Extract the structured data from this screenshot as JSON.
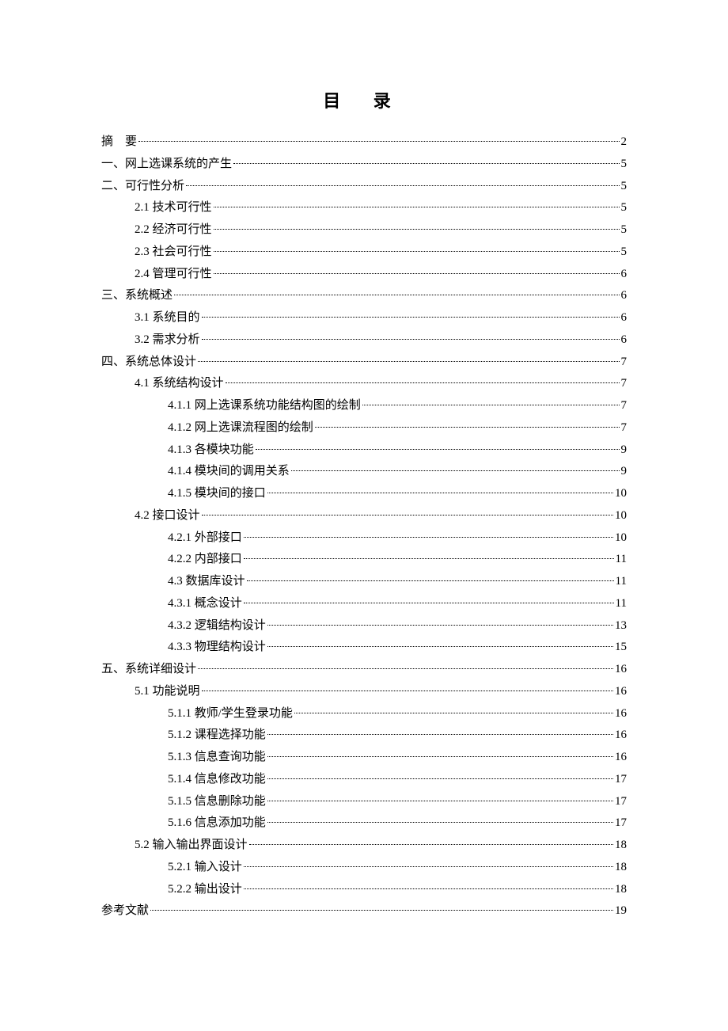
{
  "title": "目 录",
  "entries": [
    {
      "level": 0,
      "label": "摘　要",
      "page": "2"
    },
    {
      "level": 0,
      "label": "一、网上选课系统的产生",
      "page": "5"
    },
    {
      "level": 0,
      "label": "二、可行性分析",
      "page": "5"
    },
    {
      "level": 1,
      "label": "2.1 技术可行性",
      "page": "5"
    },
    {
      "level": 1,
      "label": "2.2 经济可行性",
      "page": "5"
    },
    {
      "level": 1,
      "label": "2.3 社会可行性",
      "page": "5"
    },
    {
      "level": 1,
      "label": "2.4 管理可行性",
      "page": "6"
    },
    {
      "level": 0,
      "label": "三、系统概述",
      "page": "6"
    },
    {
      "level": 1,
      "label": "3.1 系统目的 ",
      "page": "6"
    },
    {
      "level": 1,
      "label": "3.2 需求分析",
      "page": "6"
    },
    {
      "level": 0,
      "label": "四、系统总体设计",
      "page": "7"
    },
    {
      "level": 1,
      "label": "4.1 系统结构设计 ",
      "page": "7"
    },
    {
      "level": 2,
      "label": "4.1.1 网上选课系统功能结构图的绘制",
      "page": "7"
    },
    {
      "level": 2,
      "label": "4.1.2 网上选课流程图的绘制",
      "page": "7"
    },
    {
      "level": 2,
      "label": "4.1.3 各模块功能",
      "page": "9"
    },
    {
      "level": 2,
      "label": "4.1.4 模块间的调用关系",
      "page": "9"
    },
    {
      "level": 2,
      "label": "4.1.5 模块间的接口",
      "page": "10"
    },
    {
      "level": 1,
      "label": "4.2 接口设计 ",
      "page": "10"
    },
    {
      "level": 2,
      "label": "4.2.1 外部接口 ",
      "page": "10"
    },
    {
      "level": 2,
      "label": "4.2.2 内部接口",
      "page": "11"
    },
    {
      "level": 2,
      "label": "4.3 数据库设计 ",
      "page": "11"
    },
    {
      "level": 2,
      "label": "4.3.1 概念设计",
      "page": "11"
    },
    {
      "level": 2,
      "label": "4.3.2 逻辑结构设计",
      "page": "13"
    },
    {
      "level": 2,
      "label": "4.3.3 物理结构设计",
      "page": "15"
    },
    {
      "level": 0,
      "label": "五、系统详细设计",
      "page": "16"
    },
    {
      "level": 1,
      "label": "5.1 功能说明",
      "page": "16"
    },
    {
      "level": 2,
      "label": "5.1.1 教师/学生登录功能 ",
      "page": "16"
    },
    {
      "level": 2,
      "label": "5.1.2 课程选择功能",
      "page": "16"
    },
    {
      "level": 2,
      "label": "5.1.3 信息查询功能",
      "page": "16"
    },
    {
      "level": 2,
      "label": "5.1.4 信息修改功能",
      "page": "17"
    },
    {
      "level": 2,
      "label": "5.1.5 信息删除功能",
      "page": "17"
    },
    {
      "level": 2,
      "label": "5.1.6 信息添加功能",
      "page": "17"
    },
    {
      "level": 1,
      "label": "5.2 输入输出界面设计",
      "page": "18"
    },
    {
      "level": 2,
      "label": "5.2.1 输入设计",
      "page": "18"
    },
    {
      "level": 2,
      "label": "5.2.2 输出设计",
      "page": "18"
    },
    {
      "level": 0,
      "label": "参考文献",
      "page": "19"
    }
  ]
}
